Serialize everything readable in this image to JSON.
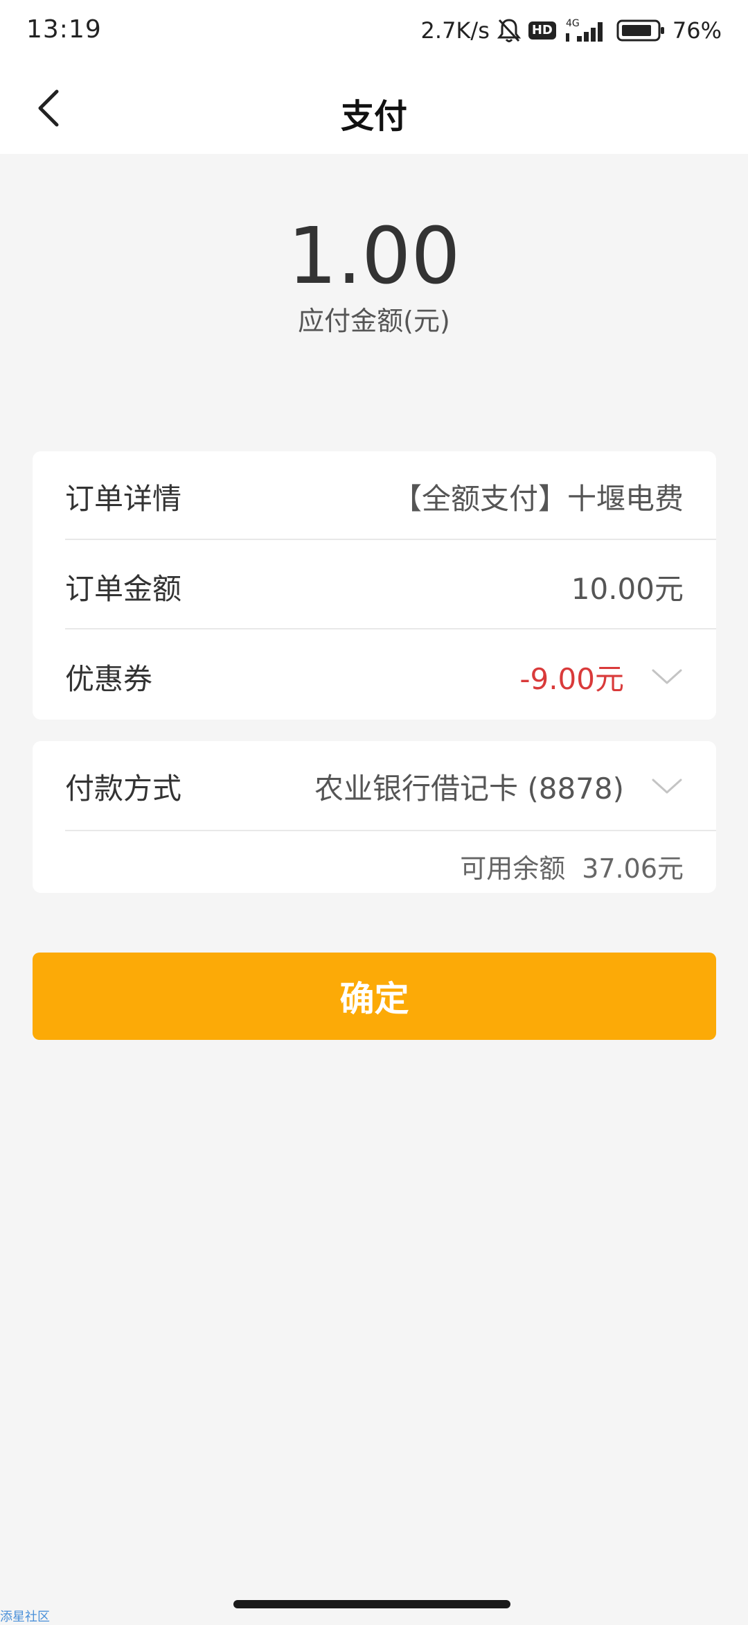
{
  "status_bar": {
    "time": "13:19",
    "network_speed": "2.7K/s",
    "hd_badge": "HD",
    "network_type": "4G",
    "battery": "76%"
  },
  "nav": {
    "title": "支付"
  },
  "amount": {
    "value": "1.00",
    "label": "应付金额(元)"
  },
  "order": {
    "details_label": "订单详情",
    "details_value": "【全额支付】十堰电费",
    "amount_label": "订单金额",
    "amount_value": "10.00元",
    "coupon_label": "优惠券",
    "coupon_value": "-9.00元"
  },
  "payment": {
    "method_label": "付款方式",
    "method_value": "农业银行借记卡 (8878)",
    "balance_label": "可用余额",
    "balance_value": "37.06元"
  },
  "confirm_label": "确定",
  "watermark": "添星社区",
  "colors": {
    "accent": "#fcaa07",
    "discount": "#d93a3a",
    "background": "#f5f5f5"
  }
}
